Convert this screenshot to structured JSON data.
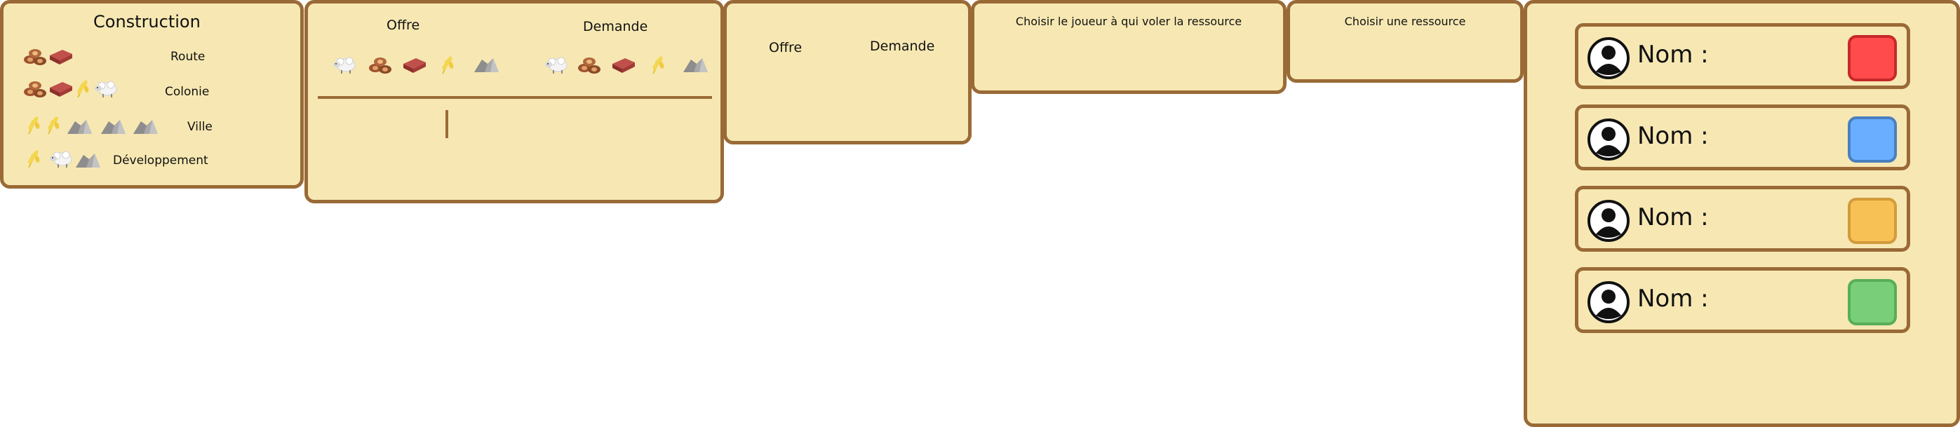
{
  "construction": {
    "title": "Construction",
    "rows": [
      {
        "label": "Route",
        "icons": [
          "wood-icon",
          "brick-icon"
        ]
      },
      {
        "label": "Colonie",
        "icons": [
          "wood-icon",
          "brick-icon",
          "wheat-icon",
          "sheep-icon"
        ]
      },
      {
        "label": "Ville",
        "icons": [
          "wheat-icon",
          "wheat-icon",
          "ore-icon",
          "ore-icon",
          "ore-icon"
        ]
      },
      {
        "label": "Développement",
        "icons": [
          "wheat-icon",
          "sheep-icon",
          "ore-icon"
        ]
      }
    ]
  },
  "trade": {
    "offer_label": "Offre",
    "demand_label": "Demande",
    "resources": [
      "sheep-icon",
      "wood-icon",
      "brick-icon",
      "wheat-icon",
      "ore-icon"
    ]
  },
  "trade_small": {
    "offer_label": "Offre",
    "demand_label": "Demande"
  },
  "steal": {
    "title": "Choisir le joueur à qui voler la ressource"
  },
  "pick_resource": {
    "title": "Choisir une ressource"
  },
  "players": [
    {
      "label": "Nom :",
      "color": "#ff4b4b",
      "border": "#c8282a",
      "icon": "user-icon"
    },
    {
      "label": "Nom :",
      "color": "#6aaeff",
      "border": "#4a7fbf",
      "icon": "user-icon"
    },
    {
      "label": "Nom :",
      "color": "#f8c155",
      "border": "#d39b3a",
      "icon": "user-icon"
    },
    {
      "label": "Nom :",
      "color": "#79cf79",
      "border": "#58ad58",
      "icon": "user-icon"
    }
  ],
  "colors": {
    "panel_bg": "#f7e8b3",
    "panel_border": "#9a6a36"
  }
}
